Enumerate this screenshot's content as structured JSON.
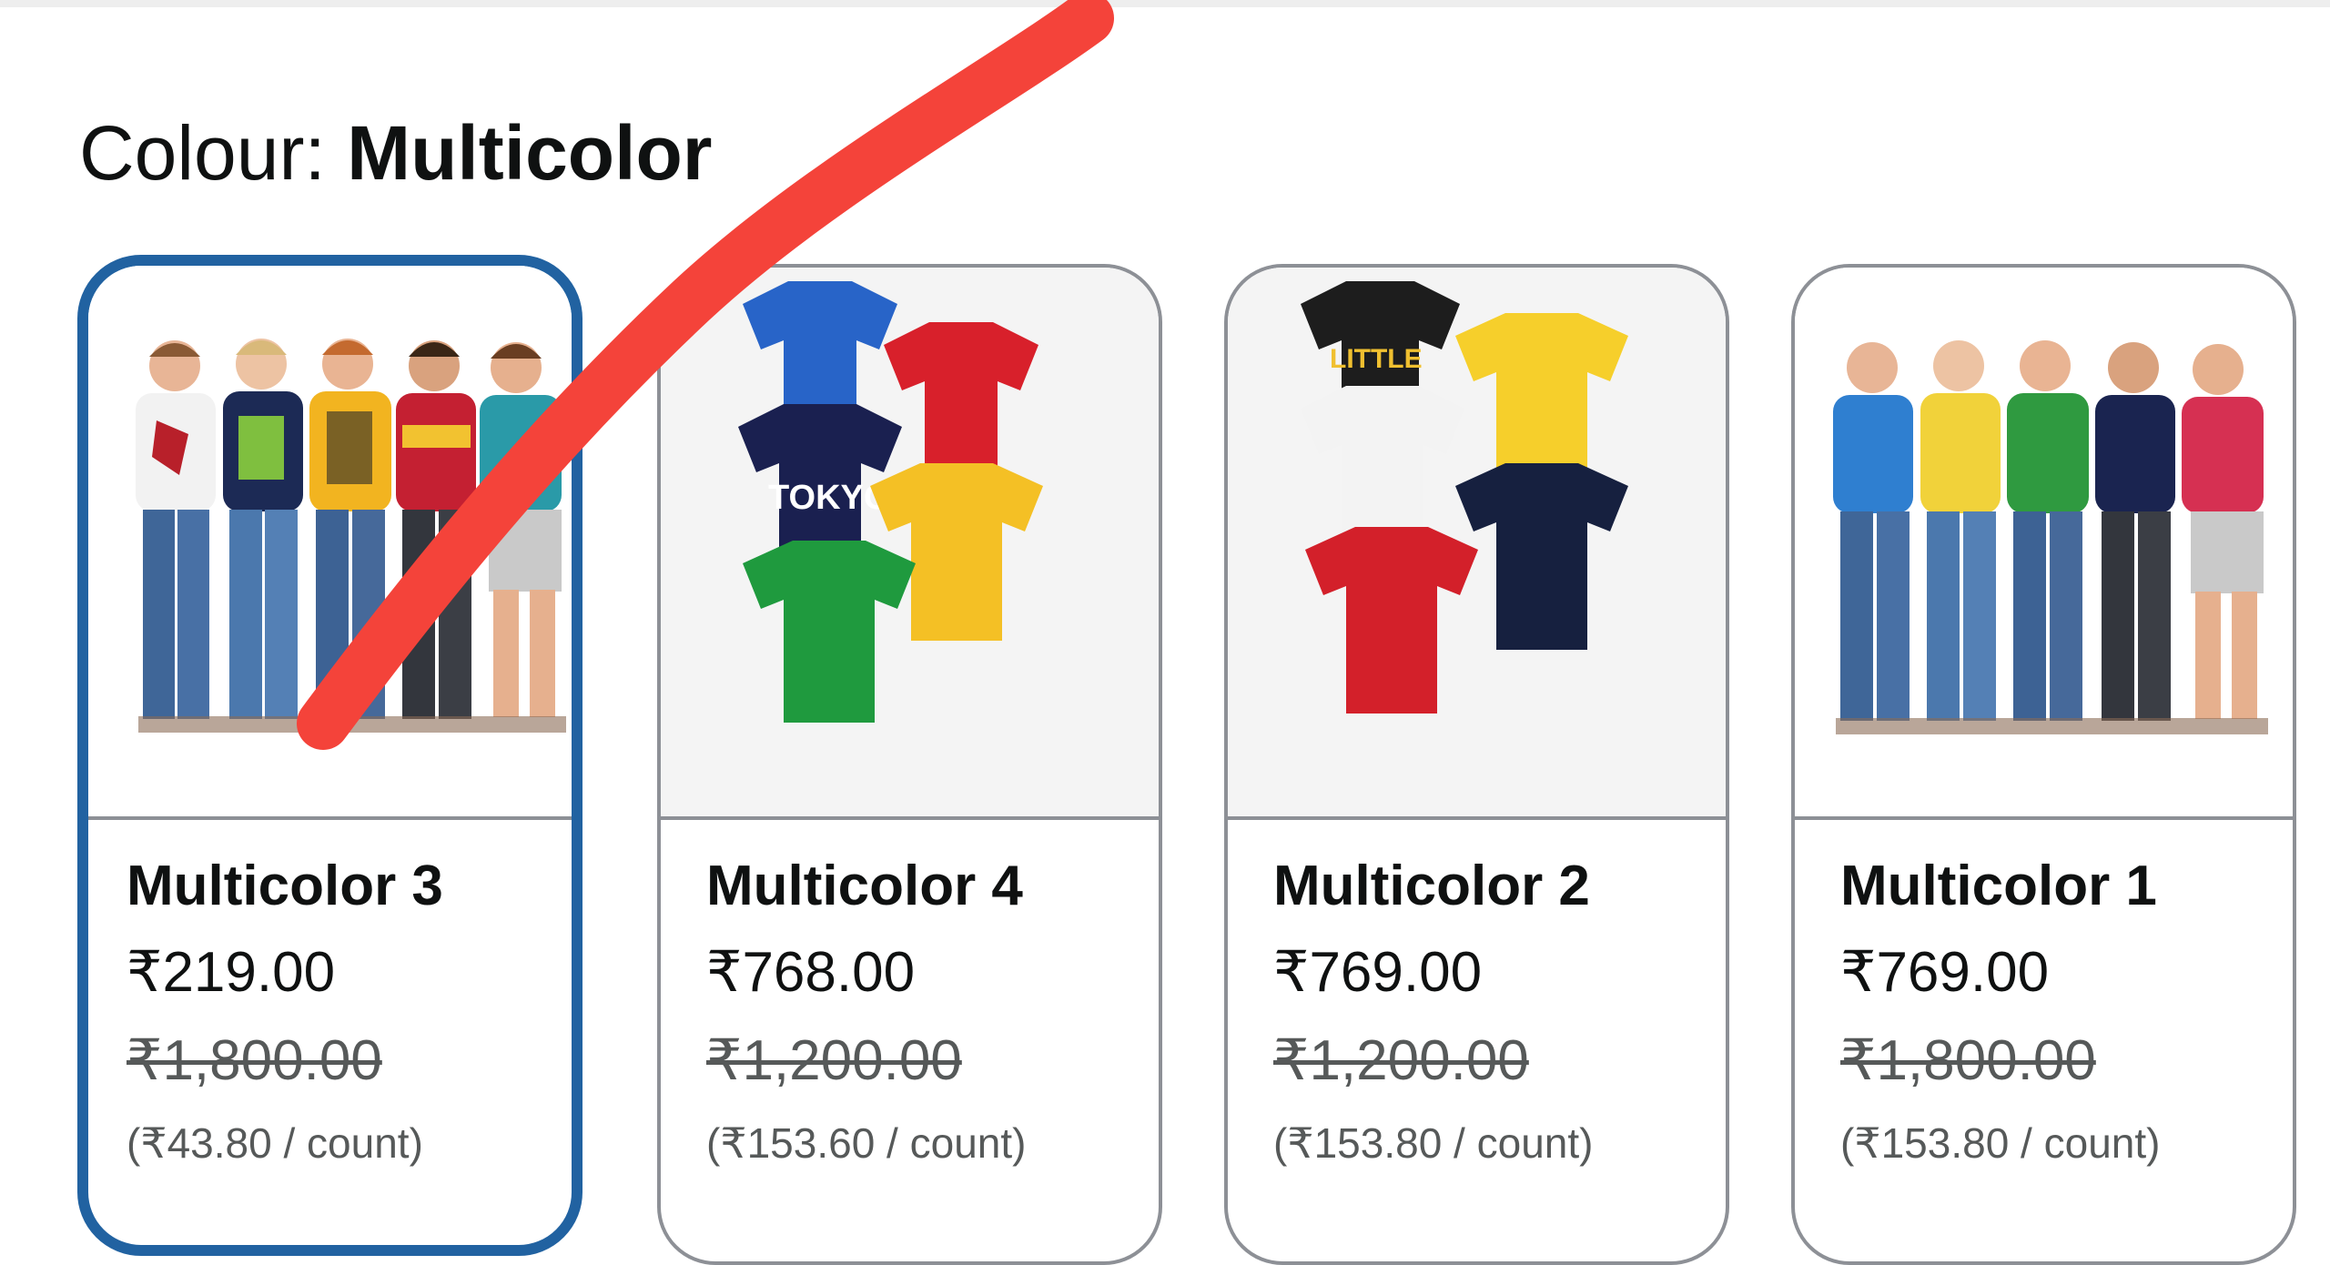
{
  "colour": {
    "label": "Colour:",
    "selected": "Multicolor"
  },
  "accent_colors": {
    "selected_border": "#2162a1",
    "card_border": "#8d9096",
    "annotation_stroke": "#f4433a"
  },
  "swatches": [
    {
      "name": "Multicolor 3",
      "price": "₹219.00",
      "list_price": "₹1,800.00",
      "unit_price": "(₹43.80 / count)",
      "selected": true,
      "image": "five-boys-group-photo"
    },
    {
      "name": "Multicolor 4",
      "price": "₹768.00",
      "list_price": "₹1,200.00",
      "unit_price": "(₹153.60 / count)",
      "selected": false,
      "image": "tshirt-pack-5"
    },
    {
      "name": "Multicolor 2",
      "price": "₹769.00",
      "list_price": "₹1,200.00",
      "unit_price": "(₹153.80 / count)",
      "selected": false,
      "image": "tshirt-pack-5"
    },
    {
      "name": "Multicolor 1",
      "price": "₹769.00",
      "list_price": "₹1,800.00",
      "unit_price": "(₹153.80 / count)",
      "selected": false,
      "image": "five-boys-group-photo"
    }
  ]
}
